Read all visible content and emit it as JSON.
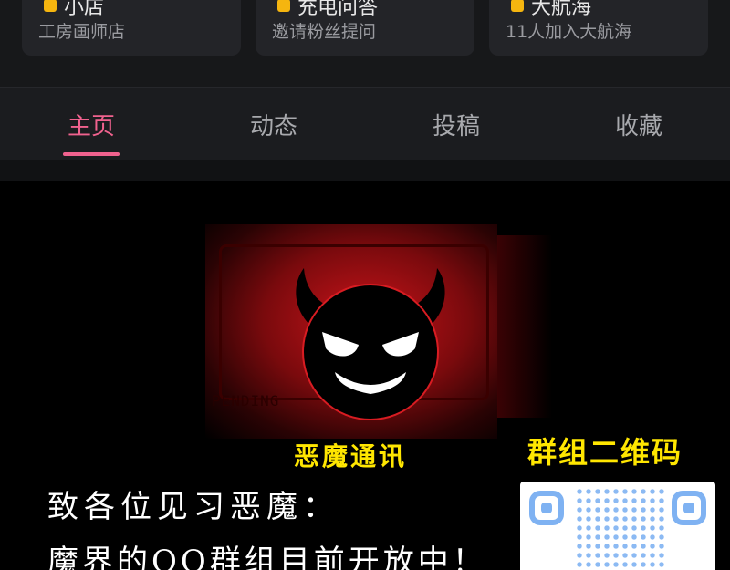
{
  "cards": [
    {
      "title": "小店",
      "subtitle": "工房画师店"
    },
    {
      "title": "充电问答",
      "subtitle": "邀请粉丝提问"
    },
    {
      "title": "大航海",
      "subtitle": "11人加入大航海"
    }
  ],
  "tabs": [
    {
      "label": "主页",
      "active": true
    },
    {
      "label": "动态",
      "active": false
    },
    {
      "label": "投稿",
      "active": false
    },
    {
      "label": "收藏",
      "active": false
    }
  ],
  "banner": {
    "plate_text": "PENDING",
    "title": "恶魔通讯",
    "qr_title": "群组二维码",
    "message_line1": "致各位见习恶魔：",
    "message_line2": "魔界的QQ群组目前开放中！"
  },
  "colors": {
    "accent": "#f0628e",
    "highlight": "#ffe600",
    "qr": "#7fb2f2"
  }
}
